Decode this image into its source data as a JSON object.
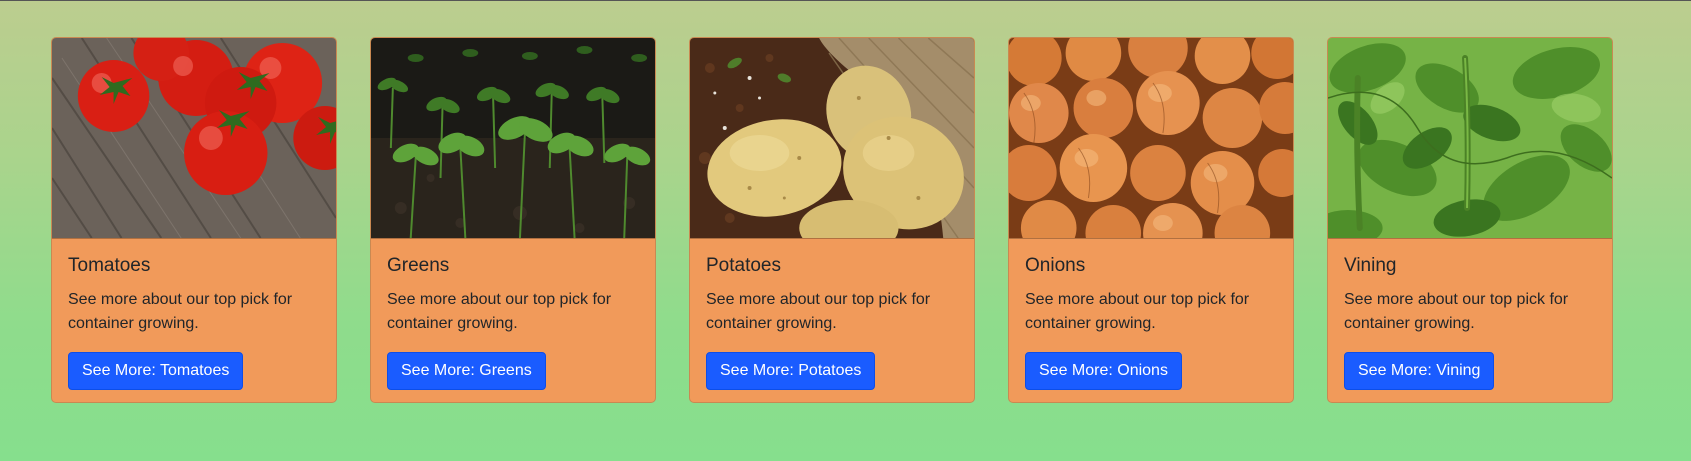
{
  "cards": [
    {
      "title": "Tomatoes",
      "text": "See more about our top pick for container growing.",
      "button_label": "See More: Tomatoes",
      "image": "tomatoes-photo"
    },
    {
      "title": "Greens",
      "text": "See more about our top pick for container growing.",
      "button_label": "See More: Greens",
      "image": "seedlings-photo"
    },
    {
      "title": "Potatoes",
      "text": "See more about our top pick for container growing.",
      "button_label": "See More: Potatoes",
      "image": "potatoes-photo"
    },
    {
      "title": "Onions",
      "text": "See more about our top pick for container growing.",
      "button_label": "See More: Onions",
      "image": "onions-photo"
    },
    {
      "title": "Vining",
      "text": "See more about our top pick for container growing.",
      "button_label": "See More: Vining",
      "image": "bean-vines-photo"
    }
  ],
  "colors": {
    "card_background": "#f19a5a",
    "button": "#1a5cff",
    "page_gradient_top": "#bccd8f",
    "page_gradient_bottom": "#86df8d"
  }
}
